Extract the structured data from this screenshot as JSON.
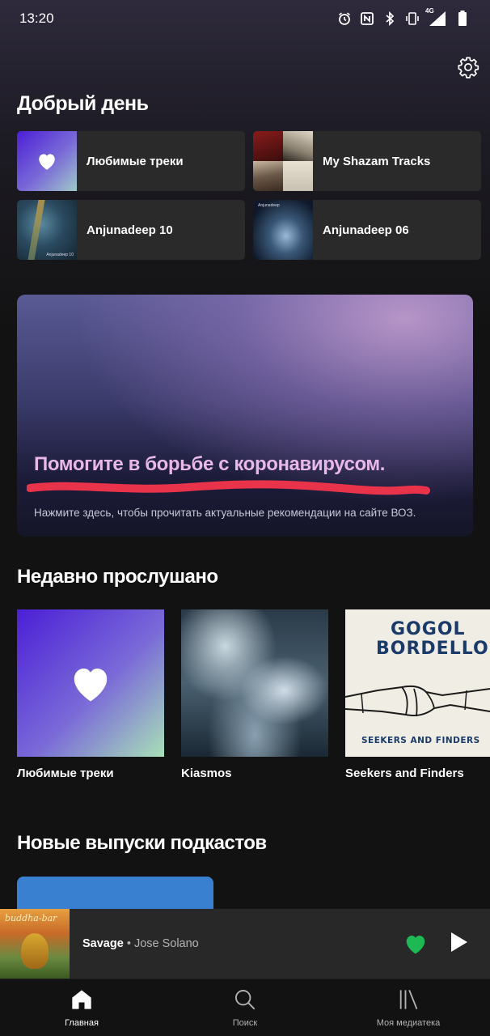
{
  "status": {
    "time": "13:20",
    "net_label": "4G",
    "icons": [
      "alarm-icon",
      "nfc-icon",
      "bluetooth-icon",
      "vibrate-icon",
      "signal-icon",
      "battery-icon"
    ]
  },
  "greeting": "Добрый день",
  "shortcuts": [
    {
      "label": "Любимые треки",
      "icon": "heart-icon"
    },
    {
      "label": "My Shazam Tracks",
      "icon": "collage-art"
    },
    {
      "label": "Anjunadeep 10",
      "icon": "aerial-art",
      "art_caption": "Anjunadeep 10"
    },
    {
      "label": "Anjunadeep 06",
      "icon": "ice-art",
      "art_caption": "Anjunadeep"
    }
  ],
  "banner": {
    "title": "Помогите в борьбе с коронавирусом.",
    "subtitle": "Нажмите здесь, чтобы прочитать актуальные рекомендации на сайте ВОЗ."
  },
  "recent": {
    "title": "Недавно прослушано",
    "items": [
      {
        "label": "Любимые треки"
      },
      {
        "label": "Kiasmos"
      },
      {
        "label": "Seekers and Finders",
        "art_text_top": "GOGOL",
        "art_text_mid": "BORDELLO",
        "art_text_bottom": "SEEKERS AND FINDERS"
      }
    ]
  },
  "podcasts": {
    "title": "Новые выпуски подкастов"
  },
  "player": {
    "track": "Savage",
    "separator": " • ",
    "artist": "Jose Solano",
    "art_text": "buddha-bar",
    "liked": true
  },
  "nav": [
    {
      "label": "Главная",
      "active": true
    },
    {
      "label": "Поиск",
      "active": false
    },
    {
      "label": "Моя медиатека",
      "active": false
    }
  ],
  "colors": {
    "accent_green": "#1db954",
    "background": "#121212",
    "card": "#2a2a2a",
    "banner_title": "#e8b8e8",
    "underline": "#e8334a"
  }
}
